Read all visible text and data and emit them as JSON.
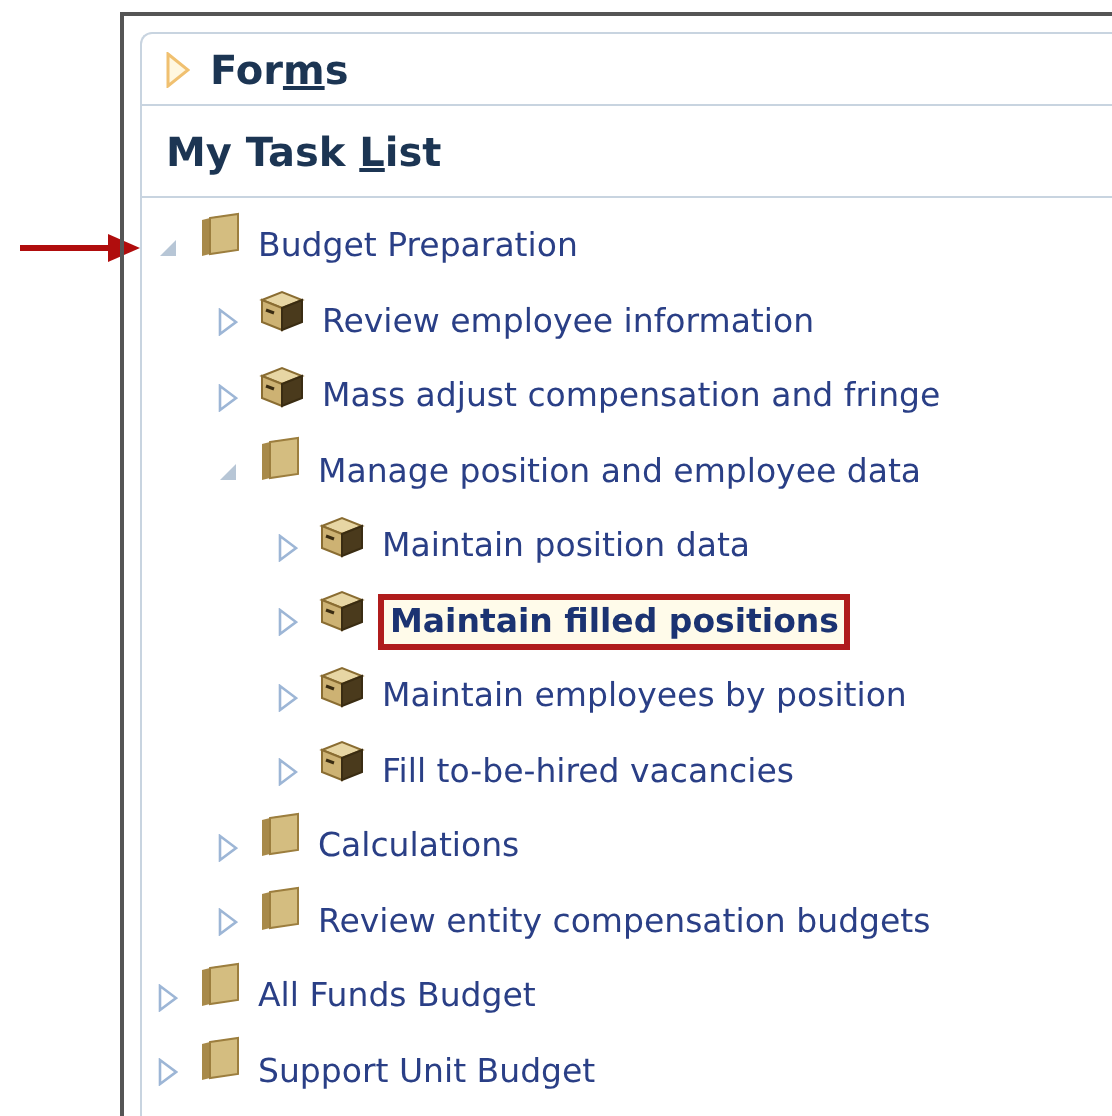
{
  "callout_arrow": true,
  "sections": [
    {
      "label_before": "For",
      "mnemonic": "m",
      "label_after": "s",
      "kind": "collapsible",
      "expanded": false
    },
    {
      "label_before": "My Task ",
      "mnemonic": "L",
      "label_after": "ist",
      "kind": "plain"
    }
  ],
  "tree": [
    {
      "label": "Budget Preparation",
      "kind": "folder",
      "expanded": true,
      "selected": false,
      "children": [
        {
          "label": "Review employee information",
          "kind": "task",
          "expanded": false,
          "selected": false
        },
        {
          "label": "Mass adjust compensation and fringe",
          "kind": "task",
          "expanded": false,
          "selected": false
        },
        {
          "label": "Manage position and employee data",
          "kind": "folder",
          "expanded": true,
          "selected": false,
          "children": [
            {
              "label": "Maintain position data",
              "kind": "task",
              "expanded": false,
              "selected": false
            },
            {
              "label": "Maintain filled positions",
              "kind": "task",
              "expanded": false,
              "selected": true
            },
            {
              "label": "Maintain employees by position",
              "kind": "task",
              "expanded": false,
              "selected": false
            },
            {
              "label": "Fill to-be-hired vacancies",
              "kind": "task",
              "expanded": false,
              "selected": false
            }
          ]
        },
        {
          "label": "Calculations",
          "kind": "folder",
          "expanded": false,
          "selected": false
        },
        {
          "label": "Review entity compensation budgets",
          "kind": "folder",
          "expanded": false,
          "selected": false
        }
      ]
    },
    {
      "label": "All Funds Budget",
      "kind": "folder",
      "expanded": false,
      "selected": false
    },
    {
      "label": "Support Unit Budget",
      "kind": "folder",
      "expanded": false,
      "selected": false
    }
  ]
}
